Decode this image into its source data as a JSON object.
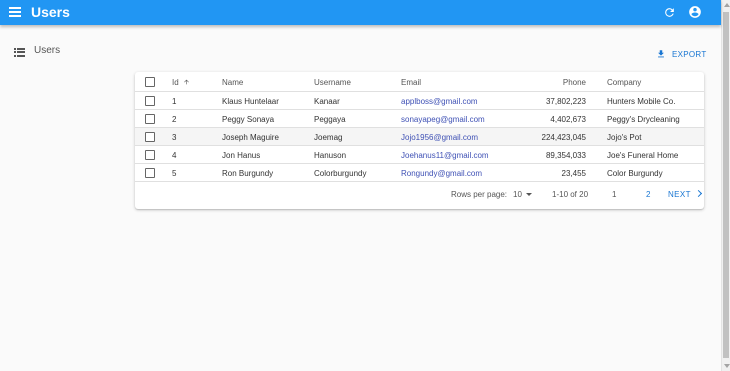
{
  "appbar": {
    "title": "Users",
    "color": "#2196f3"
  },
  "sidebar": {
    "items": [
      {
        "label": "Users",
        "icon": "list-icon"
      }
    ]
  },
  "toolbar": {
    "export_label": "EXPORT"
  },
  "table": {
    "columns": [
      "Id",
      "Name",
      "Username",
      "Email",
      "Phone",
      "Company"
    ],
    "sort": {
      "column": "Id",
      "direction": "asc"
    },
    "rows": [
      {
        "id": "1",
        "name": "Klaus Huntelaar",
        "username": "Kanaar",
        "email": "applboss@gmail.com",
        "phone": "37,802,223",
        "company": "Hunters Mobile Co."
      },
      {
        "id": "2",
        "name": "Peggy Sonaya",
        "username": "Peggaya",
        "email": "sonayapeg@gmail.com",
        "phone": "4,402,673",
        "company": "Peggy's Drycleaning"
      },
      {
        "id": "3",
        "name": "Joseph Maguire",
        "username": "Joemag",
        "email": "Jojo1956@gmail.com",
        "phone": "224,423,045",
        "company": "Jojo's Pot"
      },
      {
        "id": "4",
        "name": "Jon Hanus",
        "username": "Hanuson",
        "email": "Joehanus11@gmail.com",
        "phone": "89,354,033",
        "company": "Joe's Funeral Home"
      },
      {
        "id": "5",
        "name": "Ron Burgundy",
        "username": "Colorburgundy",
        "email": "Rongundy@gmail.com",
        "phone": "23,455",
        "company": "Color Burgundy"
      }
    ]
  },
  "pagination": {
    "rows_per_page_label": "Rows per page:",
    "rows_per_page_value": "10",
    "range": "1-10 of 20",
    "pages": [
      "1",
      "2"
    ],
    "next_label": "NEXT"
  }
}
